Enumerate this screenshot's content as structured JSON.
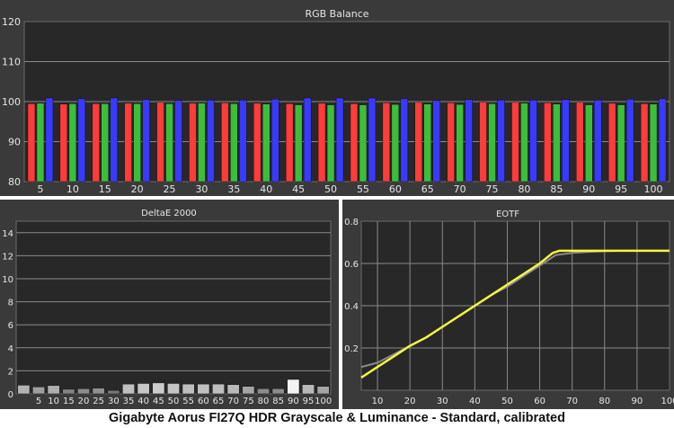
{
  "caption": "Gigabyte Aorus FI27Q HDR Grayscale & Luminance - Standard, calibrated",
  "colors": {
    "bg": "#3a3a3a",
    "plot": "#282828",
    "grid": "#8a8a8a",
    "text": "#e6e6e6",
    "red": "#ff3b3b",
    "green": "#3bbf3b",
    "blue": "#3a3aff",
    "eotf_target": "#8a8a8a",
    "eotf_measured": "#f5f542"
  },
  "chart_data": [
    {
      "type": "bar",
      "title": "RGB Balance",
      "categories": [
        "5",
        "10",
        "15",
        "20",
        "25",
        "30",
        "35",
        "40",
        "45",
        "50",
        "55",
        "60",
        "65",
        "70",
        "75",
        "80",
        "85",
        "90",
        "95",
        "100"
      ],
      "ylim": [
        80,
        120
      ],
      "yticks": [
        80,
        90,
        100,
        110,
        120
      ],
      "grid": true,
      "series": [
        {
          "color": "red",
          "values": [
            99.5,
            99.4,
            99.5,
            99.6,
            99.8,
            99.6,
            99.7,
            99.6,
            99.5,
            99.6,
            99.5,
            99.7,
            99.8,
            99.7,
            99.9,
            99.8,
            99.7,
            99.8,
            99.6,
            99.5
          ]
        },
        {
          "color": "green",
          "values": [
            99.6,
            99.5,
            99.5,
            99.5,
            99.5,
            99.6,
            99.5,
            99.4,
            99.2,
            99.2,
            99.2,
            99.3,
            99.4,
            99.3,
            99.5,
            99.6,
            99.4,
            99.2,
            99.2,
            99.4
          ]
        },
        {
          "color": "blue",
          "values": [
            100.9,
            100.7,
            100.9,
            100.5,
            100.3,
            100.4,
            100.4,
            100.6,
            100.9,
            100.9,
            100.9,
            100.7,
            100.3,
            100.5,
            100.4,
            100.4,
            100.5,
            100.4,
            100.6,
            100.7
          ]
        }
      ]
    },
    {
      "type": "bar",
      "title": "DeltaE 2000",
      "categories": [
        "5",
        "10",
        "15",
        "20",
        "25",
        "30",
        "35",
        "40",
        "45",
        "50",
        "55",
        "60",
        "65",
        "70",
        "75",
        "80",
        "85",
        "90",
        "95",
        "100"
      ],
      "values": [
        0.75,
        0.6,
        0.72,
        0.4,
        0.45,
        0.5,
        0.3,
        0.85,
        0.9,
        0.95,
        0.9,
        0.85,
        0.85,
        0.85,
        0.8,
        0.65,
        0.45,
        0.45,
        1.25,
        0.8,
        0.65
      ],
      "ylim": [
        0,
        15
      ],
      "yticks": [
        0,
        2,
        4,
        6,
        8,
        10,
        12,
        14
      ],
      "grid": true
    },
    {
      "type": "line",
      "title": "EOTF",
      "xlim": [
        5,
        100
      ],
      "ylim": [
        0,
        0.8
      ],
      "xticks": [
        10,
        20,
        30,
        40,
        50,
        60,
        70,
        80,
        90,
        100
      ],
      "yticks": [
        0.2,
        0.4,
        0.6,
        0.8
      ],
      "grid": true,
      "series": [
        {
          "color": "eotf_target",
          "x": [
            5,
            10,
            15,
            20,
            25,
            30,
            35,
            40,
            45,
            50,
            55,
            60,
            65,
            70,
            75,
            80,
            85,
            90,
            95,
            100
          ],
          "y": [
            0.11,
            0.13,
            0.17,
            0.21,
            0.25,
            0.3,
            0.35,
            0.4,
            0.45,
            0.49,
            0.54,
            0.59,
            0.64,
            0.65,
            0.655,
            0.658,
            0.66,
            0.66,
            0.66,
            0.66
          ]
        },
        {
          "color": "eotf_measured",
          "x": [
            5,
            10,
            15,
            20,
            25,
            30,
            35,
            40,
            45,
            50,
            55,
            60,
            64,
            66,
            70,
            75,
            80,
            85,
            90,
            95,
            100
          ],
          "y": [
            0.06,
            0.11,
            0.16,
            0.21,
            0.25,
            0.3,
            0.35,
            0.4,
            0.45,
            0.5,
            0.55,
            0.6,
            0.65,
            0.66,
            0.66,
            0.66,
            0.66,
            0.66,
            0.66,
            0.66,
            0.66
          ]
        }
      ]
    }
  ]
}
